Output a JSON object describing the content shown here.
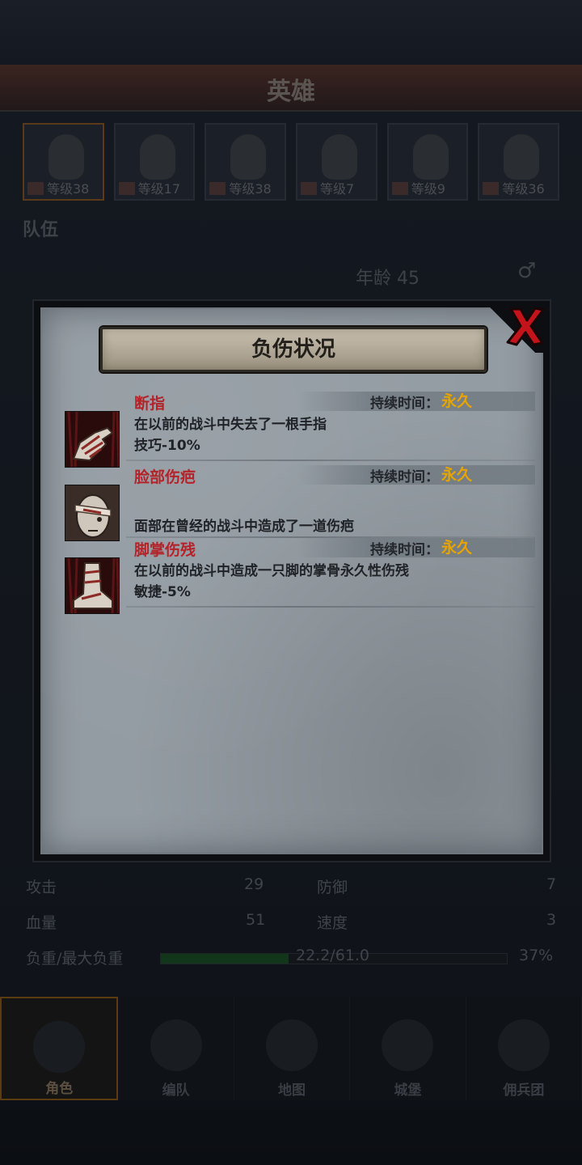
{
  "background": {
    "screen_title": "英雄",
    "heroes": [
      {
        "level_label": "等级38",
        "selected": true
      },
      {
        "level_label": "等级17",
        "selected": false
      },
      {
        "level_label": "等级38",
        "selected": false
      },
      {
        "level_label": "等级7",
        "selected": false
      },
      {
        "level_label": "等级9",
        "selected": false
      },
      {
        "level_label": "等级36",
        "selected": false
      }
    ],
    "team_label": "队伍",
    "age_label": "年龄",
    "age_value": "45",
    "gender_symbol": "♂",
    "stats": {
      "attack_label": "攻击",
      "attack_value": "29",
      "defense_label": "防御",
      "defense_value": "7",
      "hp_label": "血量",
      "hp_value": "51",
      "speed_label": "速度",
      "speed_value": "3",
      "load_label": "负重/最大负重",
      "load_value": "22.2/61.0",
      "load_percent_label": "37%",
      "load_fraction": 0.37
    },
    "nav": [
      {
        "label": "角色",
        "active": true
      },
      {
        "label": "编队",
        "active": false
      },
      {
        "label": "地图",
        "active": false
      },
      {
        "label": "城堡",
        "active": false
      },
      {
        "label": "佣兵团",
        "active": false
      }
    ]
  },
  "modal": {
    "title": "负伤状况",
    "close_icon": "close-x-icon",
    "injuries": [
      {
        "name": "断指",
        "description": "在以前的战斗中失去了一根手指",
        "effect": "技巧-10%",
        "duration_label": "持续时间：",
        "duration_value": "永久",
        "icon": "bandaged-hand-icon"
      },
      {
        "name": "脸部伤疤",
        "description": "面部在曾经的战斗中造成了一道伤疤",
        "effect": "",
        "duration_label": "持续时间：",
        "duration_value": "永久",
        "icon": "bandaged-face-icon"
      },
      {
        "name": "脚掌伤残",
        "description": "在以前的战斗中造成一只脚的掌骨永久性伤残",
        "effect": "敏捷-5%",
        "duration_label": "持续时间：",
        "duration_value": "永久",
        "icon": "bandaged-foot-icon"
      }
    ]
  },
  "colors": {
    "injury_name": "#b5232a",
    "duration_value": "#e8a400",
    "panel": "#949ca3"
  }
}
